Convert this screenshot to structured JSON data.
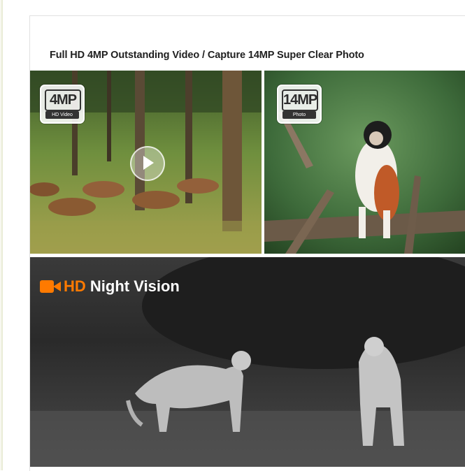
{
  "headline": "Full HD 4MP Outstanding Video / Capture 14MP Super Clear Photo",
  "badges": {
    "video": {
      "big": "4MP",
      "small": "HD Video"
    },
    "photo": {
      "big": "14MP",
      "small": "Photo"
    }
  },
  "night": {
    "hd": "HD",
    "text": "Night Vision"
  },
  "icons": {
    "play": "play-icon",
    "camera": "video-camera-icon"
  },
  "colors": {
    "accent": "#ff7a00",
    "headline": "#202020",
    "background": "#ffffff"
  }
}
